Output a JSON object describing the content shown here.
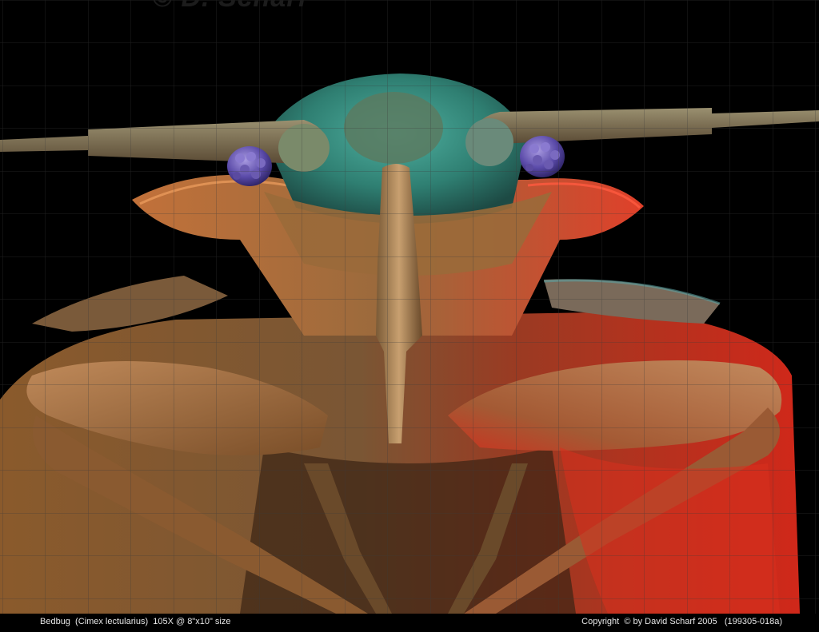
{
  "image": {
    "subject": "bedbug",
    "watermark_text": "© D. Scharf",
    "colors": {
      "background": "#000000",
      "head_cyan": "#3f9a8a",
      "body_orange": "#b8733a",
      "body_red": "#d8301e",
      "eye_purple": "#6a5ab0",
      "grid": "#3a3a3a"
    }
  },
  "caption": {
    "left": "Bedbug  (Cimex lectularius)  105X @ 8\"x10\" size",
    "right": "Copyright  © by David Scharf 2005   (199305-018a)"
  }
}
